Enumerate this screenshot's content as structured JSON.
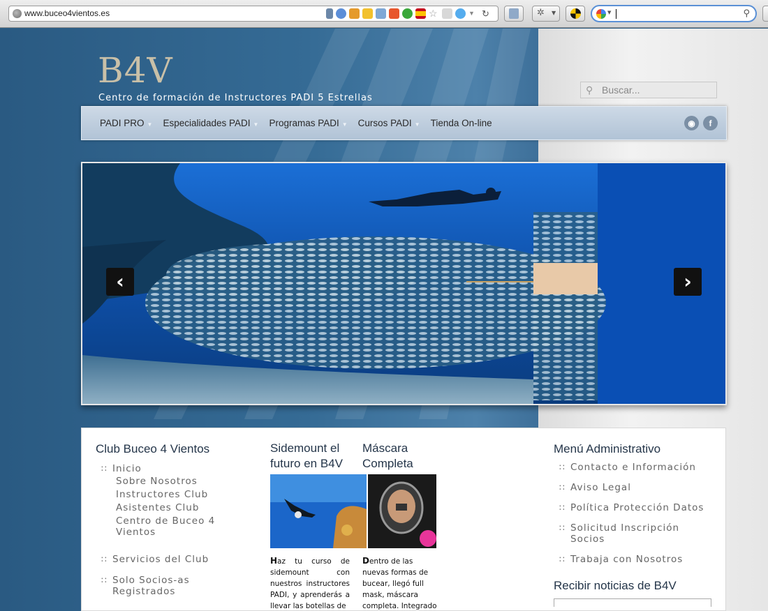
{
  "browser": {
    "url": "www.buceo4vientos.es",
    "search_value": ""
  },
  "site": {
    "logo": "B4V",
    "tagline": "Centro de formación de Instructores PADI 5 Estrellas",
    "search_placeholder": "Buscar..."
  },
  "nav": {
    "items": [
      {
        "label": "PADI PRO",
        "has_dropdown": true
      },
      {
        "label": "Especialidades PADI",
        "has_dropdown": true
      },
      {
        "label": "Programas PADI",
        "has_dropdown": true
      },
      {
        "label": "Cursos PADI",
        "has_dropdown": true
      },
      {
        "label": "Tienda On-line",
        "has_dropdown": false
      }
    ],
    "social": {
      "rss": "rss-icon",
      "facebook": "facebook-icon"
    }
  },
  "slider": {
    "prev_icon": "chevron-left-icon",
    "next_icon": "chevron-right-icon"
  },
  "left_widget": {
    "title": "Club Buceo 4 Vientos",
    "items": [
      {
        "label": "Inicio",
        "children": [
          "Sobre Nosotros",
          "Instructores Club",
          "Asistentes Club",
          "Centro de Buceo 4 Vientos"
        ]
      },
      {
        "label": "Servicios del Club"
      },
      {
        "label": "Solo Socios-as Registrados"
      }
    ]
  },
  "posts": [
    {
      "title": "Sidemount el futuro en B4V",
      "text_lead": "H",
      "text": "az tu curso de sidemount con nuestros instructores PADI, y aprenderás a llevar las botellas de"
    },
    {
      "title": "Máscara Completa",
      "text_lead": "D",
      "text": "entro de las nuevas formas de bucear, llegó full mask, máscara completa. Integrado el"
    }
  ],
  "right_widget": {
    "title": "Menú Administrativo",
    "items": [
      "Contacto e Información",
      "Aviso Legal",
      "Política Protección Datos",
      "Solicitud Inscripción Socios",
      "Trabaja con Nosotros"
    ],
    "news_title": "Recibir noticias de B4V"
  }
}
